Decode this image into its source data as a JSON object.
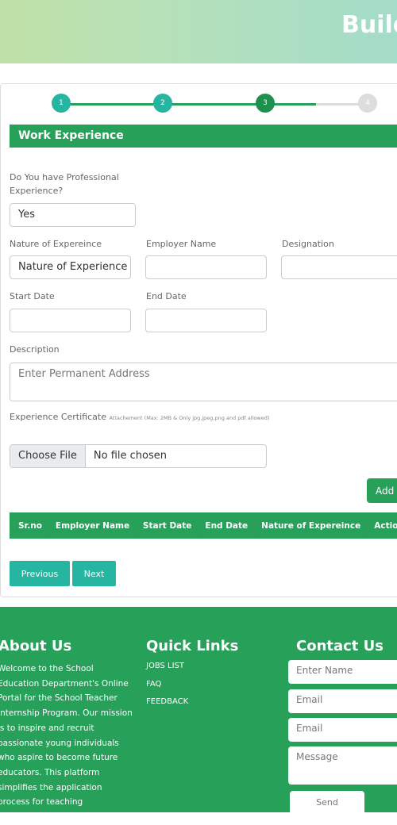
{
  "hero": {
    "title": "Build"
  },
  "stepper": {
    "steps": [
      "1",
      "2",
      "3",
      "4"
    ],
    "active": 3
  },
  "section": {
    "title": "Work Experience"
  },
  "form": {
    "professional_label": "Do You have Professional Experience?",
    "professional_value": "Yes",
    "nature_label": "Nature of Expereince",
    "nature_value": "Nature of Experience",
    "employer_label": "Employer Name",
    "employer_value": "",
    "designation_label": "Designation",
    "designation_value": "",
    "start_label": "Start Date",
    "end_label": "End Date",
    "description_label": "Description",
    "description_placeholder": "Enter Permanent Address",
    "certificate_label": "Experience Certificate",
    "certificate_note": "Attachement (Max: 2MB & Only jpg,jpeg,png and pdf allowed)",
    "choose_file": "Choose File",
    "no_file": "No file chosen",
    "add_button": "Add"
  },
  "table": {
    "headers": [
      "Sr.no",
      "Employer Name",
      "Start Date",
      "End Date",
      "Nature of Expereince",
      "Action"
    ]
  },
  "nav": {
    "previous": "Previous",
    "next": "Next"
  },
  "footer": {
    "about_title": "About Us",
    "about_text": "Welcome to the School Education Department's Online Portal for the School Teacher Internship Program. Our mission is to inspire and recruit passionate young individuals who aspire to become future educators. This platform simplifies the application process for teaching internships,",
    "links_title": "Quick Links",
    "links": [
      "JOBS LIST",
      "FAQ",
      "FEEDBACK"
    ],
    "contact_title": "Contact Us",
    "name_placeholder": "Enter Name",
    "email_placeholder": "Email",
    "email2_placeholder": "Email",
    "message_placeholder": "Message",
    "send": "Send"
  },
  "colors": {
    "green": "#27a05a",
    "teal": "#26b5a0",
    "step_active": "#1f8f4e",
    "step_inactive": "#dddddd"
  }
}
